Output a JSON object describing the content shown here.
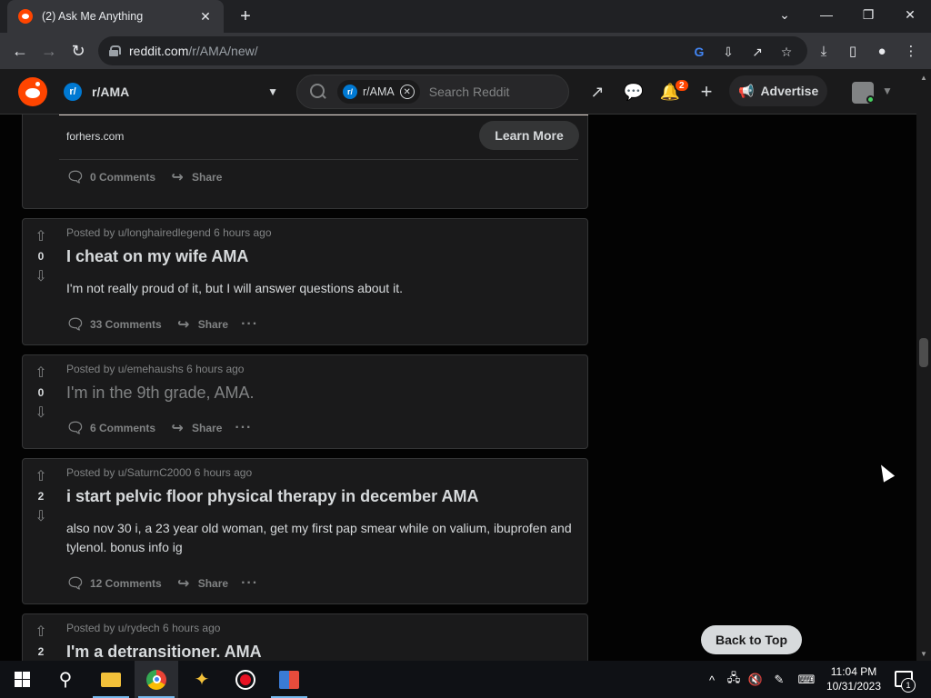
{
  "browser": {
    "tab_title": "(2) Ask Me Anything",
    "url_host": "reddit.com",
    "url_path": "/r/AMA/new/"
  },
  "reddit_header": {
    "subreddit": "r/AMA",
    "search_chip": "r/AMA",
    "search_placeholder": "Search Reddit",
    "notification_count": "2",
    "advertise_label": "Advertise"
  },
  "ad": {
    "domain": "forhers.com",
    "cta": "Learn More",
    "comments": "0 Comments",
    "share": "Share"
  },
  "posts": [
    {
      "meta": "Posted by u/longhairedlegend 6 hours ago",
      "votes": "0",
      "title": "I cheat on my wife AMA",
      "body": "I'm not really proud of it, but I will answer questions about it.",
      "comments": "33 Comments",
      "share": "Share"
    },
    {
      "meta": "Posted by u/emehaushs 6 hours ago",
      "votes": "0",
      "title": "I'm in the 9th grade, AMA.",
      "body": "",
      "comments": "6 Comments",
      "share": "Share"
    },
    {
      "meta": "Posted by u/SaturnC2000 6 hours ago",
      "votes": "2",
      "title": "i start pelvic floor physical therapy in december AMA",
      "body": "also nov 30 i, a 23 year old woman, get my first pap smear while on valium, ibuprofen and tylenol. bonus info ig",
      "comments": "12 Comments",
      "share": "Share"
    },
    {
      "meta": "Posted by u/rydech 6 hours ago",
      "votes": "2",
      "title": "I'm a detransitioner. AMA",
      "body": "",
      "comments": "",
      "share": ""
    }
  ],
  "back_to_top": "Back to Top",
  "taskbar": {
    "time": "11:04 PM",
    "date": "10/31/2023",
    "notification_count": "1"
  },
  "colors": {
    "reddit_orange": "#ff4500",
    "card_bg": "#1a1a1b",
    "page_bg": "#030303",
    "border": "#343536",
    "text": "#d7dadc",
    "muted": "#818384"
  }
}
